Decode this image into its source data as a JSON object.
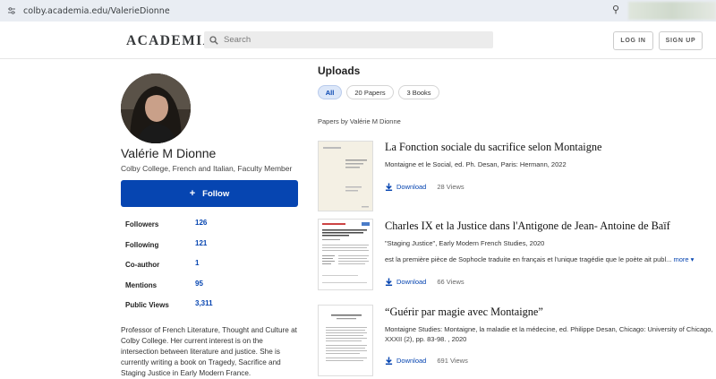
{
  "browser": {
    "url": "colby.academia.edu/ValerieDionne"
  },
  "header": {
    "logo": "ACADEMIA",
    "search_placeholder": "Search",
    "login": "LOG IN",
    "signup": "SIGN UP"
  },
  "profile": {
    "name": "Valérie M Dionne",
    "affiliation": "Colby College, French and Italian, Faculty Member",
    "follow_label": "Follow",
    "stats": [
      {
        "label": "Followers",
        "value": "126"
      },
      {
        "label": "Following",
        "value": "121"
      },
      {
        "label": "Co-author",
        "value": "1"
      },
      {
        "label": "Mentions",
        "value": "95"
      },
      {
        "label": "Public Views",
        "value": "3,311"
      }
    ],
    "bio": "Professor of French Literature, Thought and Culture at Colby College. Her current interest is on the intersection between literature and justice. She is currently writing a book on Tragedy, Sacrifice and Staging Justice in Early Modern France."
  },
  "uploads": {
    "title": "Uploads",
    "tabs": [
      {
        "label": "All",
        "active": true
      },
      {
        "label": "20 Papers",
        "active": false
      },
      {
        "label": "3 Books",
        "active": false
      }
    ],
    "papers_by": "Papers by Valérie M Dionne",
    "download_label": "Download",
    "papers": [
      {
        "title": "La Fonction sociale du sacrifice selon Montaigne",
        "meta": "Montaigne et le Social, ed. Ph. Desan, Paris: Hermann, 2022",
        "snippet": "",
        "more": "",
        "views": "28 Views"
      },
      {
        "title": "Charles IX et la Justice dans l'Antigone de Jean- Antoine de Baïf",
        "meta": "\"Staging Justice\", Early Modern French Studies, 2020",
        "snippet": "est la première pièce de Sophocle traduite en français et l'unique tragédie que le poète ait publ...",
        "more": "more",
        "views": "66 Views"
      },
      {
        "title": "“Guérir par magie avec Montaigne”",
        "meta": "Montaigne Studies: Montaigne, la maladie et la médecine, ed. Philippe Desan, Chicago: University of Chicago, XXXII (2), pp. 83-98. , 2020",
        "snippet": "",
        "more": "",
        "views": "691 Views"
      }
    ]
  }
}
